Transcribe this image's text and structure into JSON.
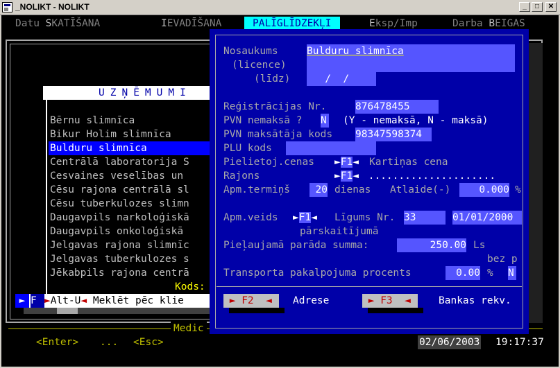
{
  "window": {
    "title": "_NOLIKT - NOLIKT",
    "btn_min": "_",
    "btn_max": "□",
    "btn_close": "✕"
  },
  "menu": {
    "items": [
      {
        "pre": "Datu ",
        "hk": "S",
        "post": "KATĪŠANA"
      },
      {
        "pre": "",
        "hk": "I",
        "post": "EVADĪŠANA"
      },
      {
        "pre": "",
        "hk": "PALĪGLĪDZEKĻI",
        "post": ""
      },
      {
        "pre": "",
        "hk": "E",
        "post": "ksp/Imp"
      },
      {
        "pre": "Darba ",
        "hk": "B",
        "post": "EIGAS"
      }
    ]
  },
  "list": {
    "header": "UZŅĒMUMI",
    "items": [
      "Bērnu slimnīca",
      "Bikur Holim slimnīca",
      "Bulduru slimnīca",
      "Centrālā laboratorija S",
      "Cesvaines veselības un ",
      "Cēsu rajona centrālā sl",
      "Cēsu tuberkulozes slimn",
      "Daugavpils narkoloģiskā",
      "Daugavpils onkoloģiskā ",
      "Jelgavas rajona slimnīc",
      "Jelgavas tuberkulozes s",
      "Jēkabpils rajona centrā"
    ],
    "selected_index": 2,
    "kods_label": "Kods:"
  },
  "hint": {
    "arrow": "►",
    "f": " F",
    "alt_arrow": "►",
    "alt_label": "Alt-U",
    "alt_arrow_right": "◄",
    "text": " Meklēt pēc klie"
  },
  "status": {
    "medic": "Medic",
    "enter": "<Enter>",
    "dots": "...",
    "esc": "<Esc>",
    "date": "02/06/2003",
    "time": "19:17:37"
  },
  "dialog": {
    "nosaukums_label": "Nosaukums",
    "nosaukums_value": "Bulduru slimnīca",
    "licence_label": "(licence)",
    "lidz_label": "(līdz)",
    "lidz_value": "   /  /",
    "reg_label": "Reģistrācijas Nr.",
    "reg_value": "876478455",
    "pvn_nemaksa_label": "PVN nemaksā ?",
    "pvn_nemaksa_value": "N",
    "pvn_nemaksa_hint": "(Y - nemaksā, N - maksā)",
    "pvn_kods_label": "PVN maksātāja kods",
    "pvn_kods_value": "98347598374",
    "plu_label": "PLU kods",
    "pielietoj_label": "Pielietoj.cenas",
    "pielietoj_key": "F1",
    "pielietoj_value": "Kartiņas cena",
    "rajons_label": "Rajons",
    "rajons_key": "F1",
    "rajons_dots": " .....................",
    "apm_termins_label": "Apm.termiņš",
    "apm_termins_value": "20",
    "dienas_label": "dienas",
    "atlaide_label": "Atlaide(-)",
    "atlaide_value": " 0.000",
    "percent": "%",
    "apm_veids_label": "Apm.veids",
    "apm_veids_key": "F1",
    "ligums_label": "Līgums Nr.",
    "ligums_value": "33",
    "ligums_date": "01/01/2000",
    "parskaitijums": "pārskaitījumā",
    "parada_label": "Pieļaujamā parāda summa:",
    "parada_value": "250.00",
    "parada_currency": "Ls",
    "bez_p": "bez p",
    "transport_label": "Transporta pakalpojuma procents",
    "transport_value": "0.00",
    "transport_percent": "%",
    "transport_flag": "N",
    "f2_label": "F2",
    "f2_text": "Adrese",
    "f3_label": "F3",
    "f3_text": "Bankas rekv."
  }
}
